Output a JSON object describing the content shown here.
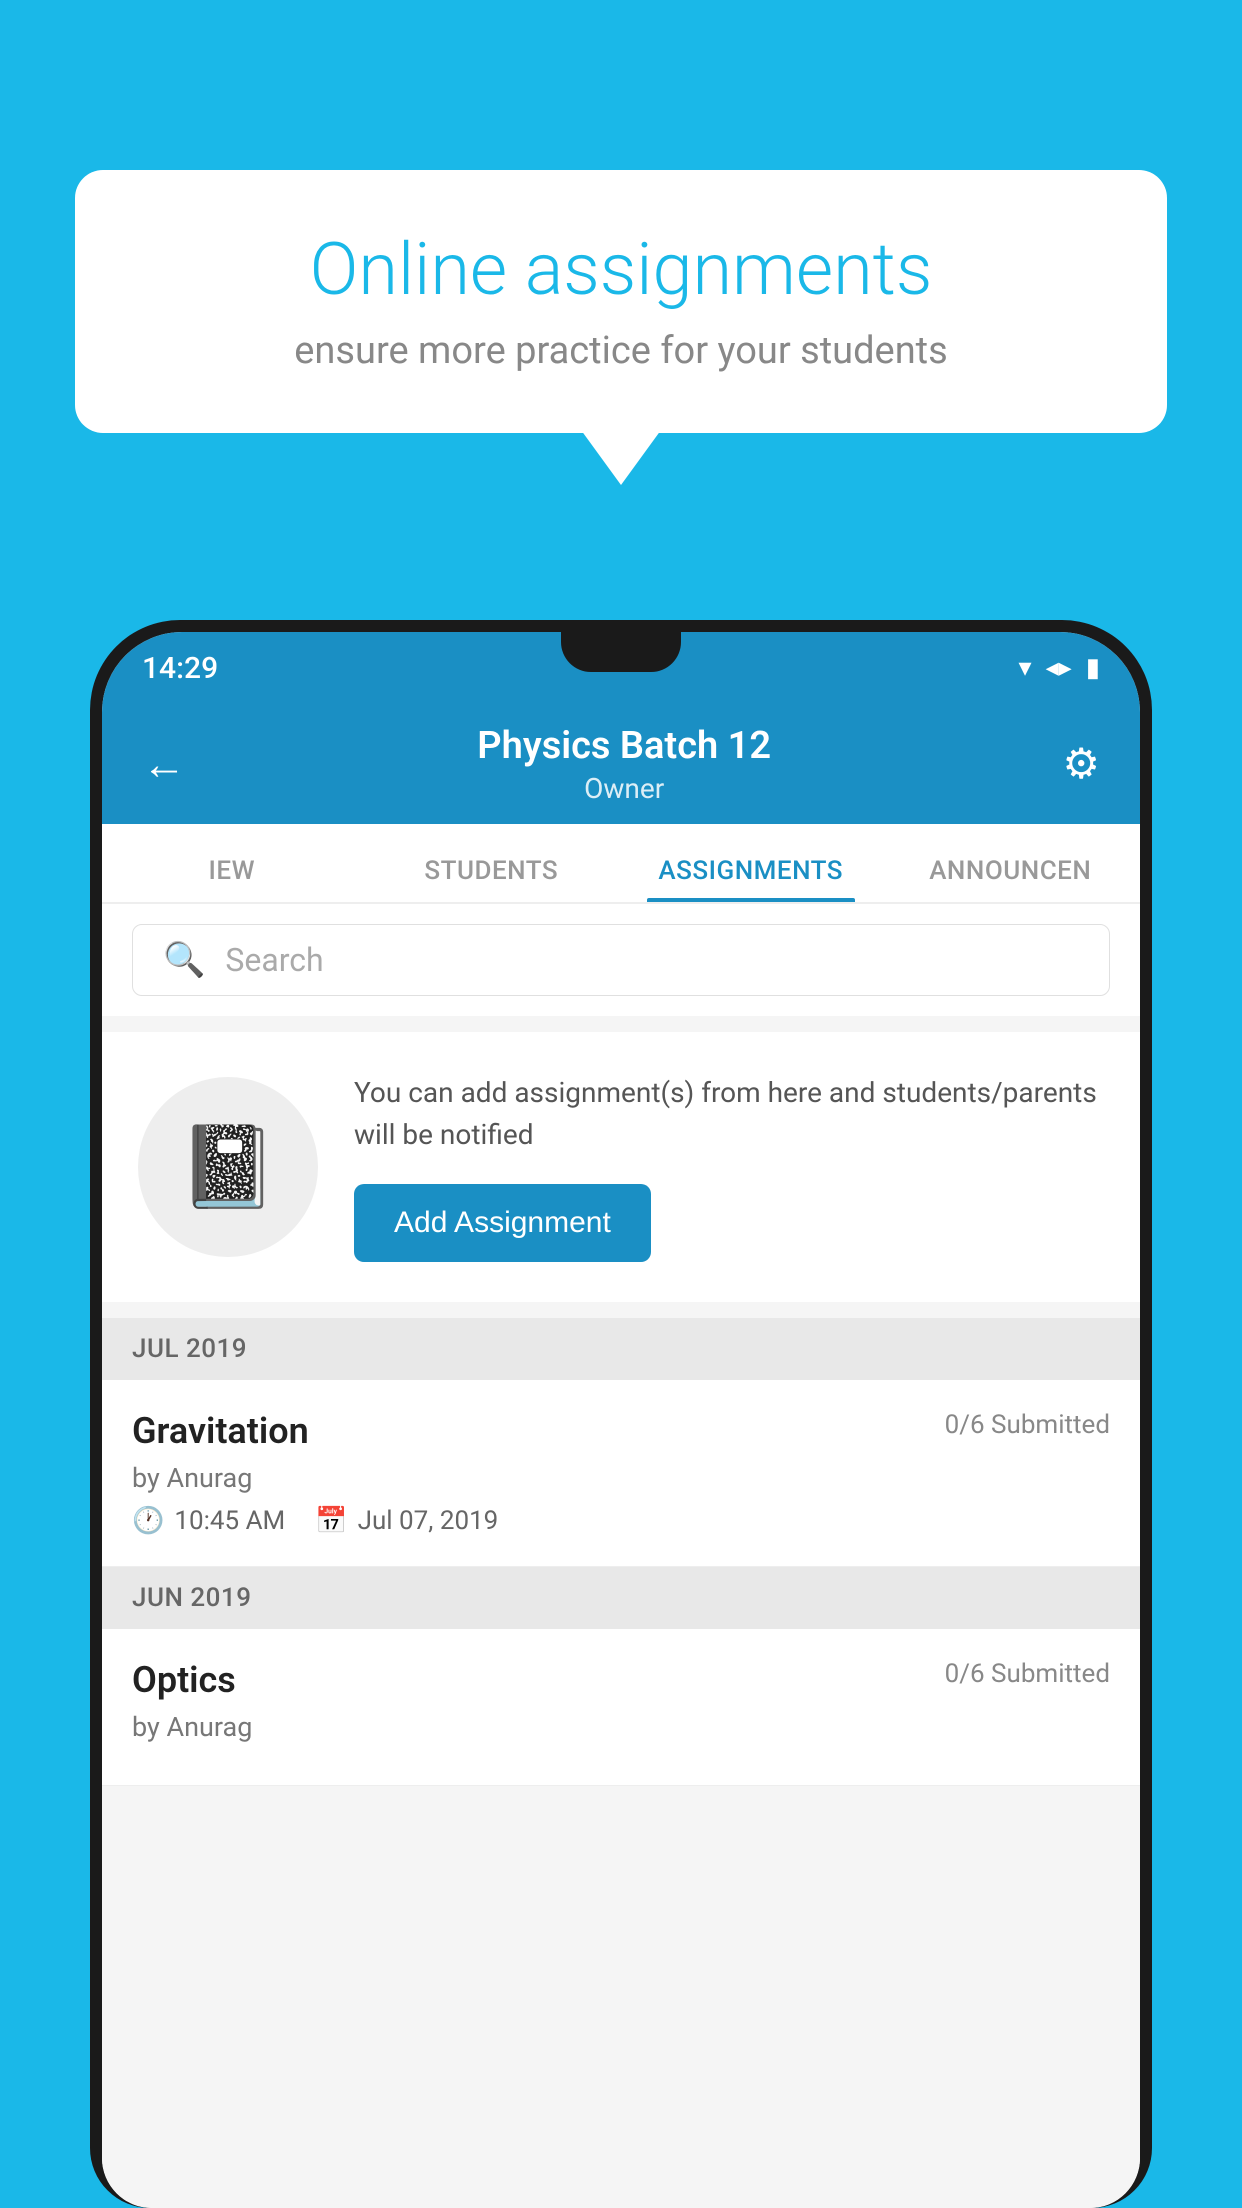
{
  "background_color": "#1ab8e8",
  "speech_bubble": {
    "title": "Online assignments",
    "subtitle": "ensure more practice for your students"
  },
  "status_bar": {
    "time": "14:29",
    "wifi_icon": "▼",
    "signal_icon": "▲",
    "battery_icon": "▮"
  },
  "header": {
    "title": "Physics Batch 12",
    "subtitle": "Owner",
    "back_label": "←",
    "settings_label": "⚙"
  },
  "tabs": [
    {
      "label": "IEW",
      "active": false
    },
    {
      "label": "STUDENTS",
      "active": false
    },
    {
      "label": "ASSIGNMENTS",
      "active": true
    },
    {
      "label": "ANNOUNCEN",
      "active": false
    }
  ],
  "search": {
    "placeholder": "Search",
    "icon": "🔍"
  },
  "empty_state": {
    "description": "You can add assignment(s) from here and students/parents will be notified",
    "button_label": "Add Assignment"
  },
  "sections": [
    {
      "label": "JUL 2019",
      "assignments": [
        {
          "name": "Gravitation",
          "submitted": "0/6 Submitted",
          "by": "by Anurag",
          "time": "10:45 AM",
          "date": "Jul 07, 2019"
        }
      ]
    },
    {
      "label": "JUN 2019",
      "assignments": [
        {
          "name": "Optics",
          "submitted": "0/6 Submitted",
          "by": "by Anurag",
          "time": "",
          "date": ""
        }
      ]
    }
  ]
}
